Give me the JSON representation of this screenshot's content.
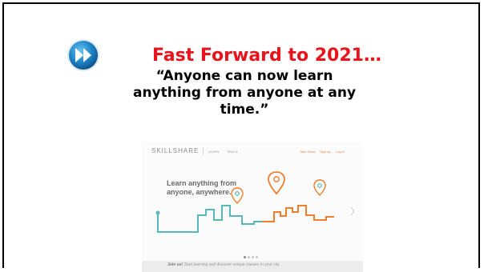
{
  "slide": {
    "title": "Fast Forward to 2021…",
    "quote": "“Anyone can now learn anything from anyone at any time.”",
    "icon": "fast-forward-icon"
  },
  "skillshare": {
    "logo": "SKILLSHARE",
    "nav_learn": "LEARN",
    "nav_teach": "TEACH",
    "nav_right": [
      "Take Class",
      "Sign up",
      "Log in"
    ],
    "hero_text": "Learn anything from anyone, anywhere.",
    "signup_lead": "Join us!",
    "signup_text": "Start learning and discover unique classes in your city",
    "colors": {
      "teal": "#58b7b9",
      "orange": "#ef7d2b",
      "title_red": "#e8141b"
    }
  }
}
